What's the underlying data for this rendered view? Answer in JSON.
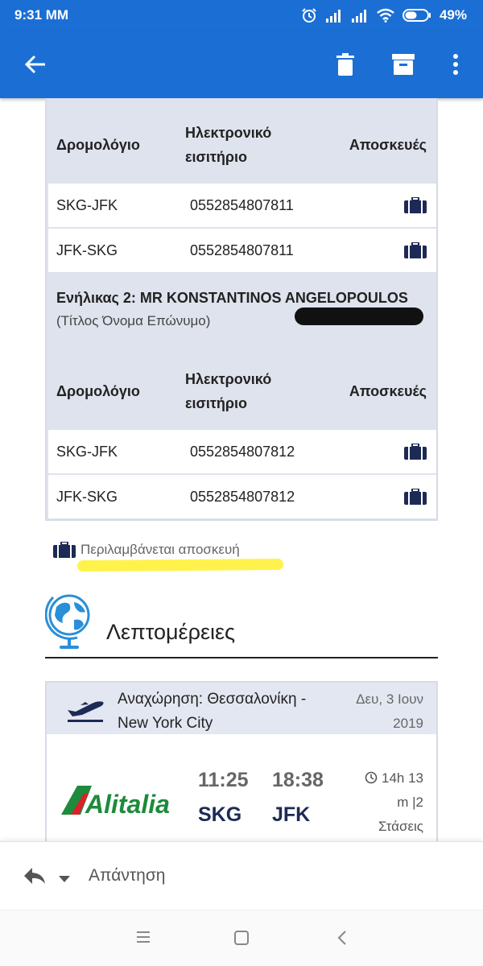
{
  "status_bar": {
    "time": "9:31 MM",
    "battery": "49%"
  },
  "app_bar": {
    "icons": [
      "back-arrow-icon",
      "trash-icon",
      "archive-icon",
      "more-vert-icon"
    ]
  },
  "table": {
    "headers": {
      "route": "Δρομολόγιο",
      "ticket_line1": "Ηλεκτρονικό",
      "ticket_line2": "εισιτήριο",
      "baggage": "Αποσκευές"
    },
    "group1_rows": [
      {
        "route": "SKG-JFK",
        "ticket": "0552854807811"
      },
      {
        "route": "JFK-SKG",
        "ticket": "0552854807811"
      }
    ],
    "passenger2": {
      "name": "Ενήλικας 2: MR KONSTANTINOS ANGELOPOULOS",
      "subtitle": "(Τίτλος Όνομα Επώνυμο)"
    },
    "group2_rows": [
      {
        "route": "SKG-JFK",
        "ticket": "0552854807812"
      },
      {
        "route": "JFK-SKG",
        "ticket": "0552854807812"
      }
    ]
  },
  "baggage_note": "Περιλαμβάνεται αποσκευή",
  "details": {
    "title": "Λεπτομέρειες"
  },
  "flight": {
    "route_line1": "Αναχώρηση: Θεσσαλονίκη -",
    "route_line2": "New York City",
    "date_line1": "Δευ, 3 Ιουν",
    "date_line2": "2019",
    "airline": "Alitalia",
    "depart_time": "11:25",
    "arrive_time": "18:38",
    "depart_code": "SKG",
    "arrive_code": "JFK",
    "duration_line1": "14h 13",
    "duration_line2": "m |2",
    "duration_line3": "Στάσεις"
  },
  "reply": {
    "label": "Απάντηση"
  },
  "colors": {
    "primary": "#1b6fd4",
    "table_header": "#dfe3ee",
    "navy": "#1c2a55",
    "highlight": "#fff13a",
    "alitalia_green": "#1e8a3c",
    "alitalia_red": "#d8232a"
  }
}
